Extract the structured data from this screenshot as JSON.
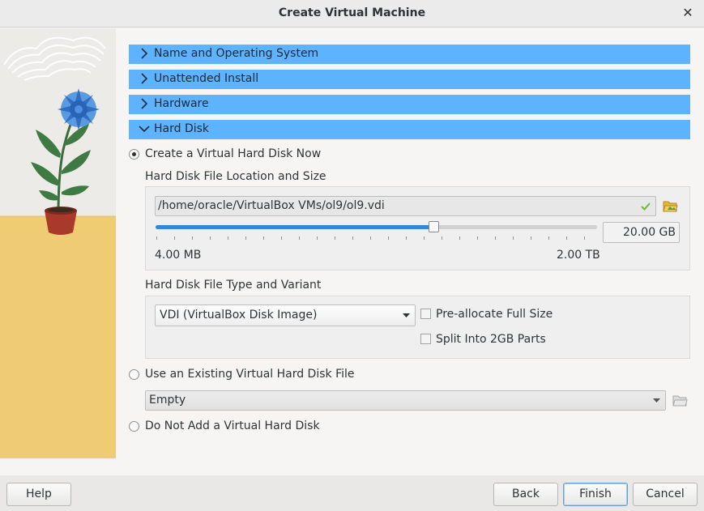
{
  "window": {
    "title": "Create Virtual Machine",
    "close_glyph": "✕"
  },
  "sections": [
    {
      "label": "Name and Operating System",
      "expanded": false
    },
    {
      "label": "Unattended Install",
      "expanded": false
    },
    {
      "label": "Hardware",
      "expanded": false
    },
    {
      "label": "Hard Disk",
      "expanded": true
    }
  ],
  "hard_disk": {
    "create_option_label": "Create a Virtual Hard Disk Now",
    "location_group_label": "Hard Disk File Location and Size",
    "file_path": "/home/oracle/VirtualBox VMs/ol9/ol9.vdi",
    "size_value": "20.00 GB",
    "size_fraction": 0.63,
    "min_label": "4.00 MB",
    "max_label": "2.00 TB",
    "type_group_label": "Hard Disk File Type and Variant",
    "type_selected": "VDI (VirtualBox Disk Image)",
    "preallocate_label": "Pre-allocate Full Size",
    "split_label": "Split Into 2GB Parts",
    "existing_option_label": "Use an Existing Virtual Hard Disk File",
    "existing_selected": "Empty",
    "none_option_label": "Do Not Add a Virtual Hard Disk",
    "selected_option": "create"
  },
  "buttons": {
    "help": "Help",
    "back": "Back",
    "finish": "Finish",
    "cancel": "Cancel"
  },
  "colors": {
    "section_header": "#5eb3ff",
    "slider_fill": "#3b83d6",
    "valid_check": "#73b53c"
  },
  "icons": {
    "close": "close-icon",
    "expand": "chevron-right-icon",
    "collapse": "chevron-down-icon",
    "valid": "checkmark-icon",
    "browse": "folder-open-icon",
    "dropdown": "dropdown-arrow-icon"
  }
}
